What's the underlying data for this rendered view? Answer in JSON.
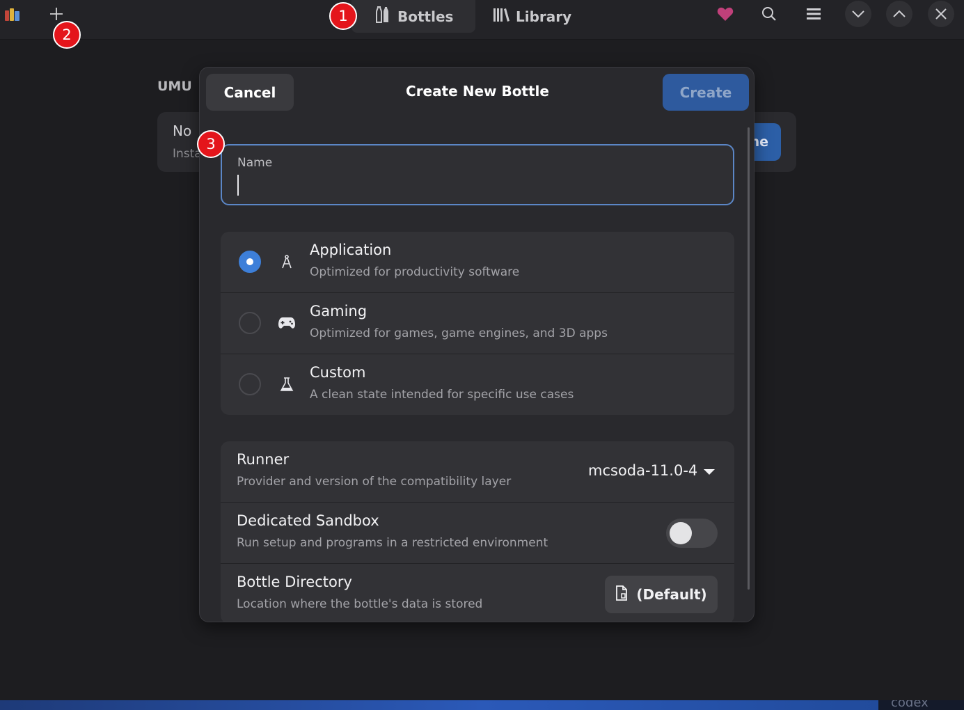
{
  "header": {
    "tabs": [
      {
        "label": "Bottles",
        "icon": "bottles-icon",
        "active": true
      },
      {
        "label": "Library",
        "icon": "library-icon",
        "active": false
      }
    ],
    "icons": [
      "app-icon",
      "add-icon",
      "heart-icon",
      "search-icon",
      "menu-icon",
      "minimize-icon",
      "maximize-icon",
      "close-icon"
    ]
  },
  "background": {
    "group_title": "UMU",
    "card_title": "No",
    "card_subtitle": "Insta",
    "card_button": "ne"
  },
  "dialog": {
    "title": "Create New Bottle",
    "cancel_label": "Cancel",
    "create_label": "Create",
    "name_field": {
      "label": "Name",
      "value": ""
    },
    "environments": [
      {
        "title": "Application",
        "subtitle": "Optimized for productivity software",
        "icon": "compass-icon",
        "selected": true
      },
      {
        "title": "Gaming",
        "subtitle": "Optimized for games, game engines, and 3D apps",
        "icon": "gamepad-icon",
        "selected": false
      },
      {
        "title": "Custom",
        "subtitle": "A clean state intended for specific use cases",
        "icon": "flask-icon",
        "selected": false
      }
    ],
    "runner": {
      "title": "Runner",
      "subtitle": "Provider and version of the compatibility layer",
      "value": "mcsoda-11.0-4"
    },
    "sandbox": {
      "title": "Dedicated Sandbox",
      "subtitle": "Run setup and programs in a restricted environment",
      "enabled": false
    },
    "directory": {
      "title": "Bottle Directory",
      "subtitle": "Location where the bottle's data is stored",
      "button_label": "(Default)"
    }
  },
  "markers": [
    "1",
    "2",
    "3"
  ],
  "taskbar_text": "codex",
  "colors": {
    "accent": "#3d7fd9",
    "heart": "#c0407a",
    "marker": "#e4151b"
  }
}
